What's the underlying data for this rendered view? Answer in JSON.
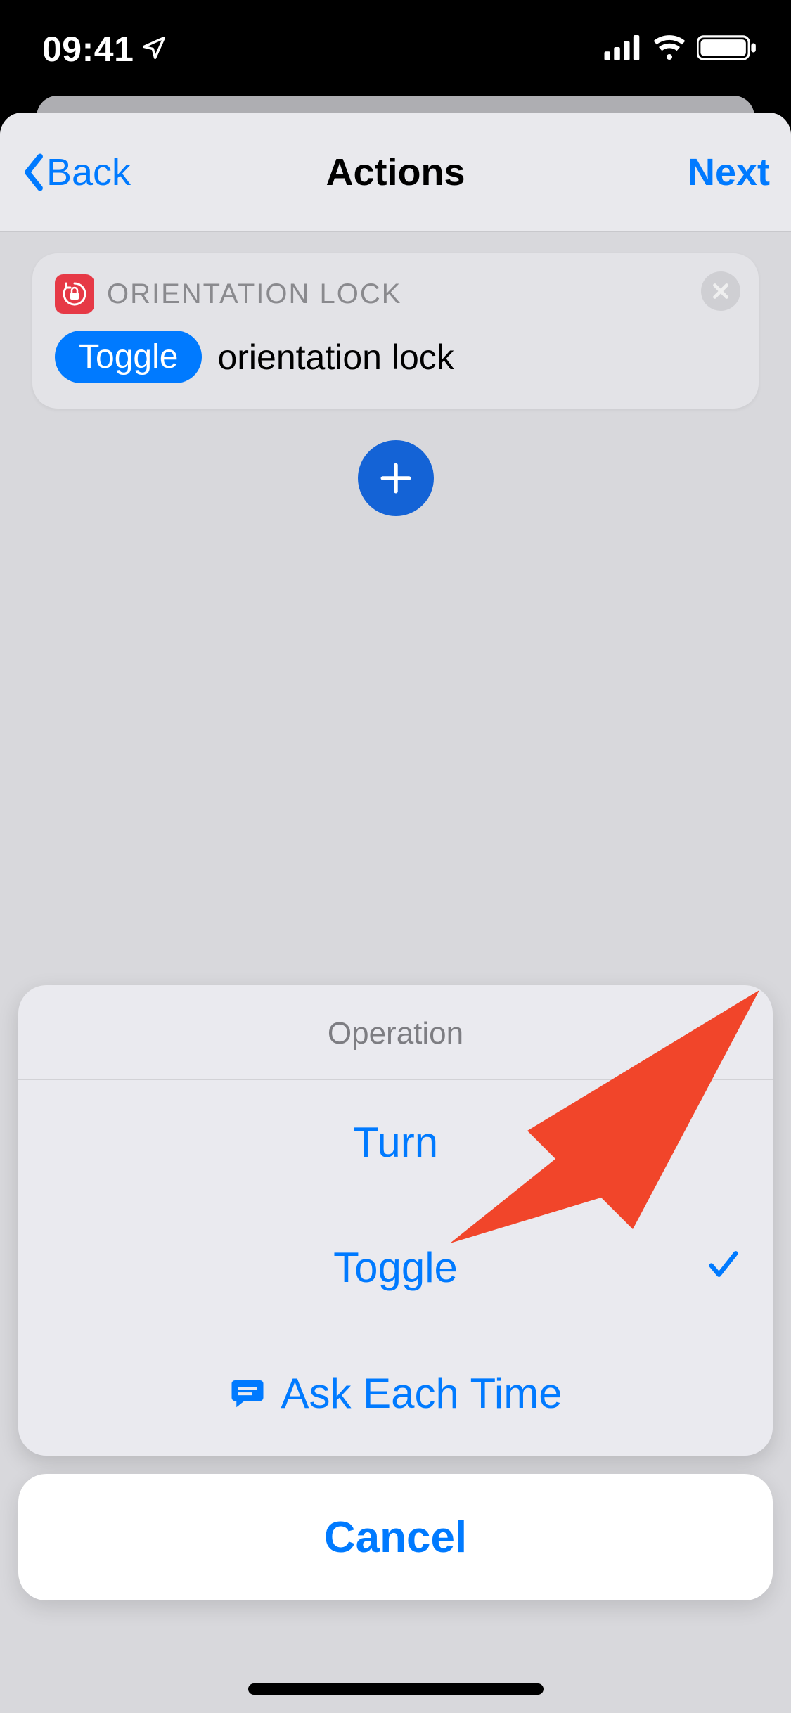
{
  "status": {
    "time": "09:41",
    "location_icon": "location-arrow",
    "signal_bars": 4,
    "wifi": true,
    "battery_percent": 100
  },
  "nav": {
    "back_label": "Back",
    "title": "Actions",
    "next_label": "Next"
  },
  "action_card": {
    "icon": "orientation-lock-icon",
    "title": "ORIENTATION LOCK",
    "chip_label": "Toggle",
    "text_after": "orientation lock"
  },
  "add_button": {
    "icon": "plus"
  },
  "action_sheet": {
    "header": "Operation",
    "options": [
      {
        "label": "Turn",
        "selected": false,
        "icon": null
      },
      {
        "label": "Toggle",
        "selected": true,
        "icon": null
      },
      {
        "label": "Ask Each Time",
        "selected": false,
        "icon": "chat-bubble"
      }
    ],
    "cancel_label": "Cancel"
  },
  "annotation": {
    "type": "arrow",
    "color": "#f1452a",
    "points_to": "option-turn"
  }
}
